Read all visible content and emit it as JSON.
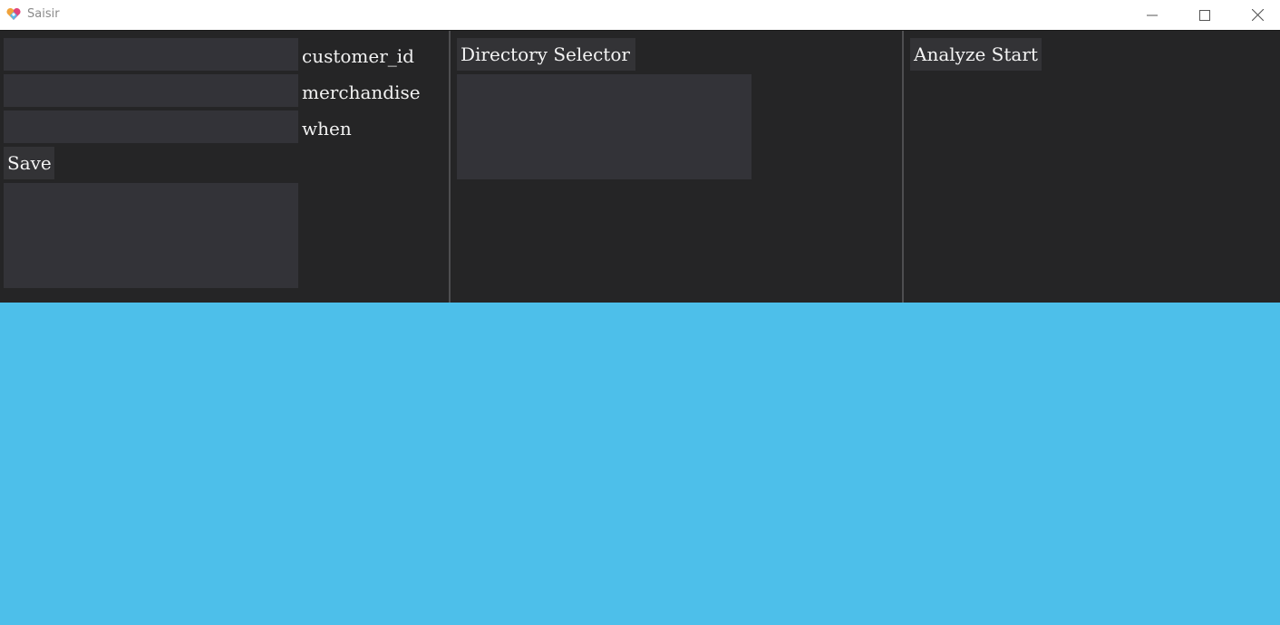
{
  "window": {
    "title": "Saisir",
    "icon": "app-logo-icon",
    "controls": [
      "minimize-icon",
      "maximize-icon",
      "close-icon"
    ]
  },
  "form": {
    "fields": [
      {
        "label": "customer_id",
        "value": ""
      },
      {
        "label": "merchandise",
        "value": ""
      },
      {
        "label": "when",
        "value": ""
      }
    ],
    "save_label": "Save",
    "output_text": ""
  },
  "directory": {
    "button_label": "Directory Selector",
    "output_text": ""
  },
  "analysis": {
    "button_label": "Analyze Start"
  },
  "colors": {
    "panel_background": "#252526",
    "widget_background": "#333338",
    "canvas_background": "#4dbfea",
    "text": "#f2f2f2"
  }
}
